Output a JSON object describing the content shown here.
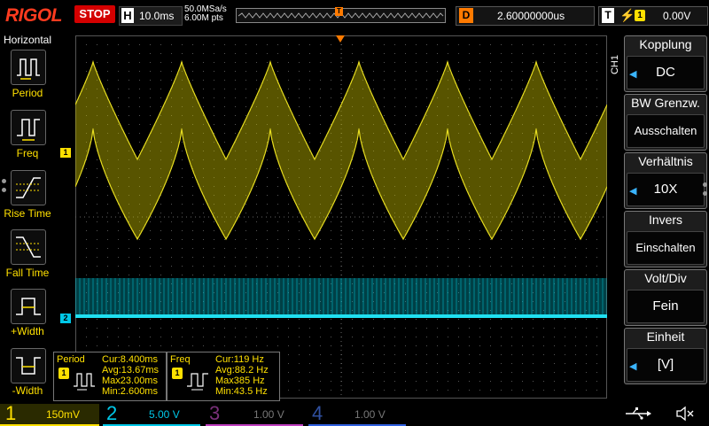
{
  "top": {
    "brand": "RIGOL",
    "run_state": "STOP",
    "horizontal_key": "H",
    "timebase": "10.0ms",
    "sample_rate": "50.0MSa/s",
    "memory_depth": "6.00M pts",
    "delay_key": "D",
    "delay_value": "2.60000000us",
    "trigger_key": "T",
    "trigger_source": "1",
    "trigger_level": "0.00V",
    "trigger_marker": "T"
  },
  "left_menu": {
    "title": "Horizontal",
    "items": [
      {
        "label": "Period"
      },
      {
        "label": "Freq"
      },
      {
        "label": "Rise Time"
      },
      {
        "label": "Fall Time"
      },
      {
        "label": "+Width"
      },
      {
        "label": "-Width"
      }
    ]
  },
  "right_menu": {
    "channel_label": "CH1",
    "items": [
      {
        "title": "Kopplung",
        "value": "DC"
      },
      {
        "title": "BW Grenzw.",
        "value": "Ausschalten"
      },
      {
        "title": "Verhältnis",
        "value": "10X"
      },
      {
        "title": "Invers",
        "value": "Einschalten"
      },
      {
        "title": "Volt/Div",
        "value": "Fein"
      },
      {
        "title": "Einheit",
        "value": "[V]"
      }
    ]
  },
  "measurements": [
    {
      "name": "Period",
      "channel": "1",
      "cur": "Cur:8.400ms",
      "avg": "Avg:13.67ms",
      "max": "Max23.00ms",
      "min": "Min:2.600ms"
    },
    {
      "name": "Freq",
      "channel": "1",
      "cur": "Cur:119 Hz",
      "avg": "Avg:88.2 Hz",
      "max": "Max385 Hz",
      "min": "Min:43.5 Hz"
    }
  ],
  "channel_markers": {
    "ch1": "1",
    "ch2": "2"
  },
  "bottom": {
    "channels": [
      {
        "num": "1",
        "scale": "150mV",
        "color": "#ffe000"
      },
      {
        "num": "2",
        "scale": "5.00 V",
        "color": "#00c8e8"
      },
      {
        "num": "3",
        "scale": "1.00 V",
        "color": "#c040c0"
      },
      {
        "num": "4",
        "scale": "1.00 V",
        "color": "#3060e0"
      }
    ]
  },
  "colors": {
    "ch1": "#c8c000",
    "ch2": "#00b8c8",
    "trigger": "#ff7a00",
    "stop": "#d40000"
  }
}
